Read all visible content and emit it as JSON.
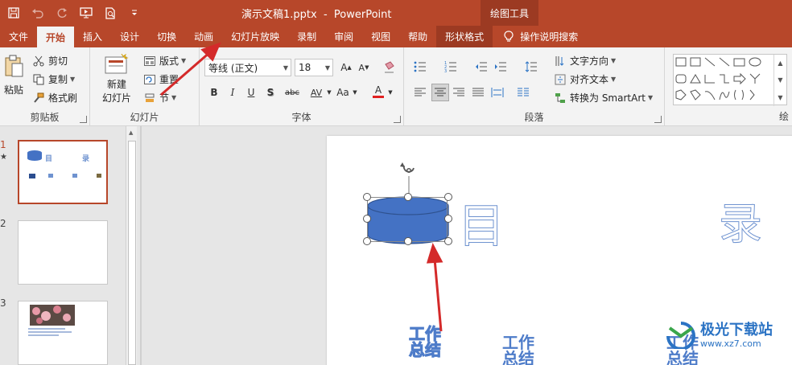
{
  "titlebar": {
    "title": "演示文稿1.pptx  -  PowerPoint",
    "context_group": "绘图工具",
    "quick_access": [
      "save-icon",
      "undo-icon",
      "redo-icon",
      "start-slideshow-icon",
      "print-preview-icon",
      "customize-qat-icon"
    ]
  },
  "tabs": {
    "file": "文件",
    "home": "开始",
    "insert": "插入",
    "design": "设计",
    "transitions": "切换",
    "animations": "动画",
    "slideshow": "幻灯片放映",
    "record": "录制",
    "review": "审阅",
    "view": "视图",
    "help": "帮助",
    "shape_format": "形状格式",
    "tell_me": "操作说明搜索"
  },
  "ribbon": {
    "clipboard": {
      "label": "剪贴板",
      "paste": "粘贴",
      "cut": "剪切",
      "copy": "复制",
      "format_painter": "格式刷"
    },
    "slides": {
      "label": "幻灯片",
      "new_slide_line1": "新建",
      "new_slide_line2": "幻灯片",
      "layout": "版式",
      "reset": "重置",
      "section": "节"
    },
    "font": {
      "label": "字体",
      "font_name": "等线 (正文)",
      "font_size": "18",
      "bold": "B",
      "italic": "I",
      "underline": "U",
      "shadow": "S",
      "strike": "abc",
      "spacing": "AV",
      "case": "Aa",
      "color_letter": "A",
      "color_accent": "#e02020"
    },
    "paragraph": {
      "label": "段落",
      "text_direction": "文字方向",
      "align_text": "对齐文本",
      "convert_smartart": "转换为 SmartArt"
    },
    "drawing": {
      "label": "绘"
    }
  },
  "thumbnails": [
    {
      "number": "1",
      "active": true,
      "title_left": "目",
      "title_right": "录"
    },
    {
      "number": "2",
      "active": false
    },
    {
      "number": "3",
      "active": false
    }
  ],
  "slide": {
    "title_left": "目",
    "title_right": "录",
    "wordart": [
      {
        "line1": "工作",
        "line2": "总结"
      },
      {
        "line1": "工作",
        "line2": "总结"
      },
      {
        "line1": "工作",
        "line2": "总结"
      }
    ],
    "shape_fill": "#4472c4"
  },
  "watermark": {
    "name": "极光下载站",
    "url": "www.xz7.com"
  },
  "colors": {
    "accent": "#b7472a",
    "arrow": "#d42a2a"
  }
}
